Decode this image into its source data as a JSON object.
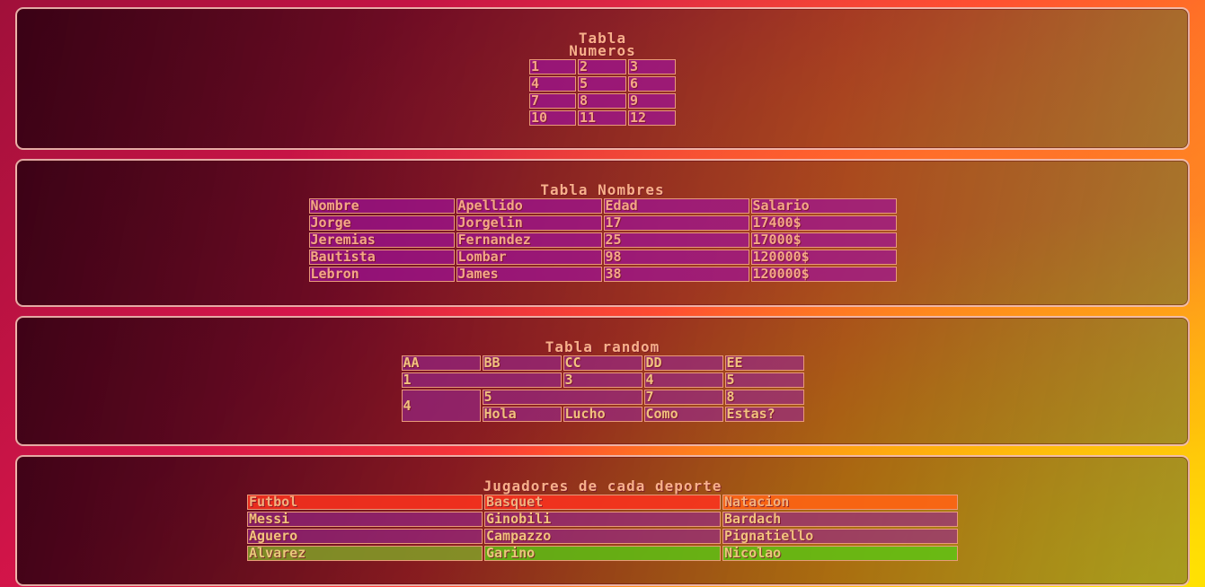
{
  "numeros": {
    "caption_line1": "Tabla",
    "caption_line2": "Numeros",
    "rows": [
      [
        "1",
        "2",
        "3"
      ],
      [
        "4",
        "5",
        "6"
      ],
      [
        "7",
        "8",
        "9"
      ],
      [
        "10",
        "11",
        "12"
      ]
    ]
  },
  "nombres": {
    "caption": "Tabla Nombres",
    "headers": [
      "Nombre",
      "Apellido",
      "Edad",
      "Salario"
    ],
    "rows": [
      [
        "Jorge",
        "Jorgelin",
        "17",
        "17400$"
      ],
      [
        "Jeremias",
        "Fernandez",
        "25",
        "17000$"
      ],
      [
        "Bautista",
        "Lombar",
        "98",
        "120000$"
      ],
      [
        "Lebron",
        "James",
        "38",
        "120000$"
      ]
    ]
  },
  "random": {
    "caption": "Tabla random",
    "headers": [
      "AA",
      "BB",
      "CC",
      "DD",
      "EE"
    ],
    "row1": [
      "1",
      "3",
      "4",
      "5"
    ],
    "row2": [
      "4",
      "5",
      "7",
      "8"
    ],
    "row3": [
      "Hola",
      "Lucho",
      "Como",
      "Estas?"
    ]
  },
  "deportes": {
    "caption": "Jugadores de cada deporte",
    "headers": [
      "Futbol",
      "Basquet",
      "Natacion"
    ],
    "rows": [
      [
        "Messi",
        "Ginobili",
        "Bardach"
      ],
      [
        "Aguero",
        "Campazzo",
        "Pignatiello"
      ],
      [
        "Alvarez",
        "Garino",
        "Nicolao"
      ]
    ]
  }
}
